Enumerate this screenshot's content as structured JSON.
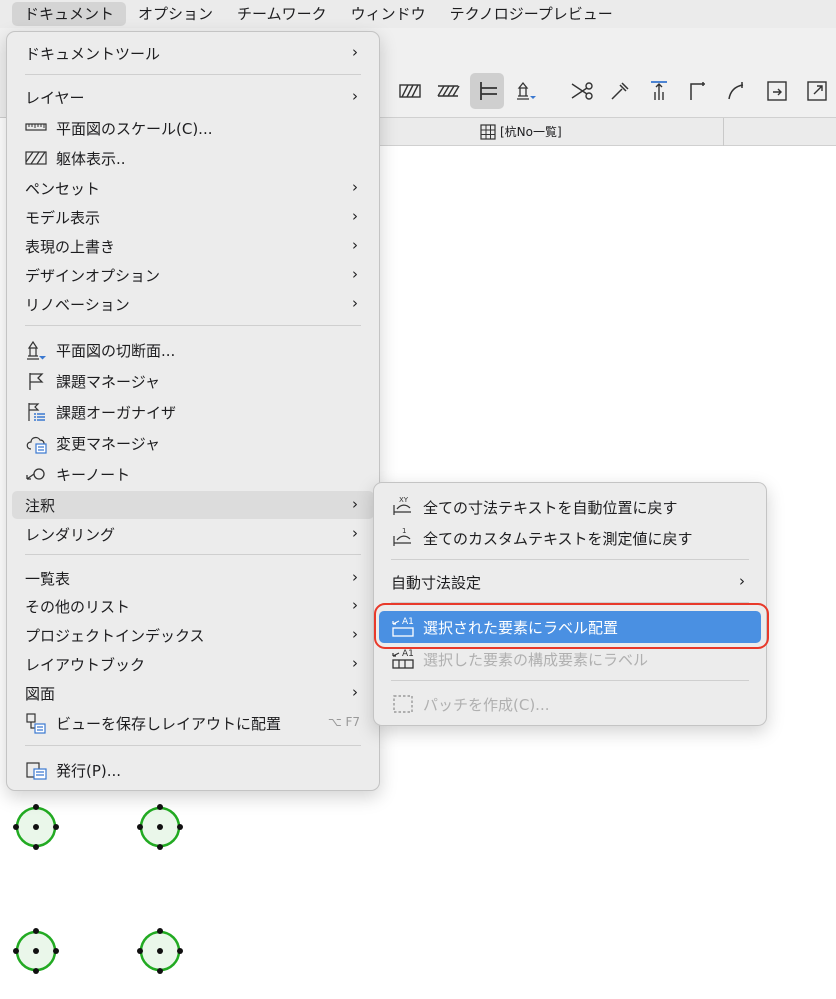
{
  "menubar": {
    "items": [
      "ドキュメント",
      "オプション",
      "チームワーク",
      "ウィンドウ",
      "テクノロジープレビュー"
    ]
  },
  "tabbar": {
    "tab_label": "[杭No一覧]"
  },
  "document_menu": {
    "items": [
      {
        "label": "ドキュメントツール",
        "icon": "",
        "submenu": true
      },
      {
        "label": "レイヤー",
        "icon": "",
        "submenu": true
      },
      {
        "label": "平面図のスケール(C)...",
        "icon": "scale-ruler-icon",
        "submenu": false
      },
      {
        "label": "躯体表示..",
        "icon": "hatch-icon",
        "submenu": false
      },
      {
        "label": "ペンセット",
        "icon": "",
        "submenu": true
      },
      {
        "label": "モデル表示",
        "icon": "",
        "submenu": true
      },
      {
        "label": "表現の上書き",
        "icon": "",
        "submenu": true
      },
      {
        "label": "デザインオプション",
        "icon": "",
        "submenu": true
      },
      {
        "label": "リノベーション",
        "icon": "",
        "submenu": true
      },
      {
        "label": "平面図の切断面...",
        "icon": "floor-plan-cut-icon",
        "submenu": false
      },
      {
        "label": "課題マネージャ",
        "icon": "flag-icon",
        "submenu": false
      },
      {
        "label": "課題オーガナイザ",
        "icon": "issue-organizer-icon",
        "submenu": false
      },
      {
        "label": "変更マネージャ",
        "icon": "cloud-list-icon",
        "submenu": false
      },
      {
        "label": "キーノート",
        "icon": "keynote-icon",
        "submenu": false
      },
      {
        "label": "注釈",
        "icon": "",
        "submenu": true,
        "highlighted": true
      },
      {
        "label": "レンダリング",
        "icon": "",
        "submenu": true
      },
      {
        "label": "一覧表",
        "icon": "",
        "submenu": true
      },
      {
        "label": "その他のリスト",
        "icon": "",
        "submenu": true
      },
      {
        "label": "プロジェクトインデックス",
        "icon": "",
        "submenu": true
      },
      {
        "label": "レイアウトブック",
        "icon": "",
        "submenu": true
      },
      {
        "label": "図面",
        "icon": "",
        "submenu": true
      },
      {
        "label": "ビューを保存しレイアウトに配置",
        "icon": "save-view-icon",
        "submenu": false,
        "shortcut": "⌥ F7"
      },
      {
        "label": "発行(P)...",
        "icon": "publish-icon",
        "submenu": false
      }
    ]
  },
  "annotation_submenu": {
    "items": [
      {
        "label": "全ての寸法テキストを自動位置に戻す",
        "icon": "dimension-xy-icon"
      },
      {
        "label": "全てのカスタムテキストを測定値に戻す",
        "icon": "dimension-reset-icon"
      },
      {
        "label": "自動寸法設定",
        "icon": "",
        "submenu": true
      },
      {
        "label": "選択された要素にラベル配置",
        "icon": "label-a1-icon",
        "selected": true
      },
      {
        "label": "選択した要素の構成要素にラベル",
        "icon": "label-a1-components-icon",
        "disabled": true
      },
      {
        "label": "パッチを作成(C)...",
        "icon": "patch-icon",
        "disabled": true
      }
    ]
  },
  "colors": {
    "selection": "#4a90e2",
    "callout_ring": "#e8392a",
    "pile_green": "#22aa22"
  }
}
